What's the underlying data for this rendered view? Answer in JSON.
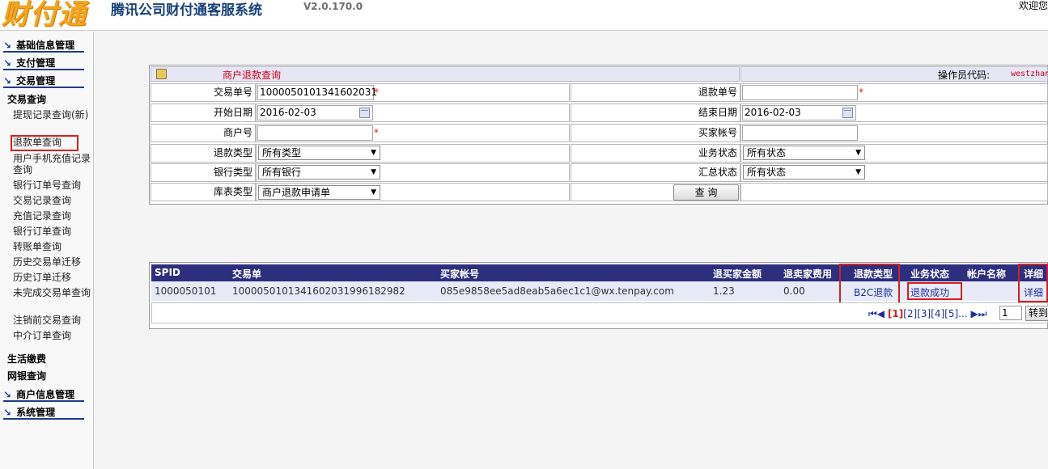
{
  "header": {
    "logo": "财付通",
    "title": "腾讯公司财付通客服系统",
    "version": "V2.0.170.0",
    "welcome": "欢迎您"
  },
  "sidebar": {
    "sections": [
      {
        "label": "基础信息管理"
      },
      {
        "label": "支付管理"
      },
      {
        "label": "交易管理"
      }
    ],
    "trade_query_heading": "交易查询",
    "items": [
      "提现记录查询(新)",
      "退款单查询",
      "用户手机充值记录查询",
      "银行订单号查询",
      "交易记录查询",
      "充值记录查询",
      "银行订单查询",
      "转账单查询",
      "历史交易单迁移",
      "历史订单迁移",
      "未完成交易单查询",
      "注销前交易查询",
      "中介订单查询"
    ],
    "life_pay": "生活缴费",
    "bank_query": "网银查询",
    "bottom_sections": [
      {
        "label": "商户信息管理"
      },
      {
        "label": "系统管理"
      }
    ]
  },
  "query": {
    "title": "商户退款查询",
    "operator_label": "操作员代码:",
    "operator_value": "westzhan",
    "trade_no_label": "交易单号",
    "trade_no_value": "1000050101341602031",
    "refund_no_label": "退款单号",
    "refund_no_value": "",
    "start_date_label": "开始日期",
    "start_date_value": "2016-02-03",
    "end_date_label": "结束日期",
    "end_date_value": "2016-02-03",
    "merchant_no_label": "商户号",
    "merchant_no_value": "",
    "buyer_account_label": "买家帐号",
    "buyer_account_value": "",
    "refund_type_label": "退款类型",
    "refund_type_value": "所有类型",
    "business_status_label": "业务状态",
    "business_status_value": "所有状态",
    "bank_type_label": "银行类型",
    "bank_type_value": "所有银行",
    "summary_status_label": "汇总状态",
    "summary_status_value": "所有状态",
    "table_type_label": "库表类型",
    "table_type_value": "商户退款申请单",
    "query_button": "查 询",
    "required_mark": "*"
  },
  "results": {
    "columns": [
      "SPID",
      "交易单",
      "买家帐号",
      "退买家金额",
      "退卖家费用",
      "退款类型",
      "业务状态",
      "帐户名称",
      "详细"
    ],
    "rows": [
      {
        "spid": "1000050101",
        "trade": "1000050101341602031996182982",
        "buyer": "085e9858ee5ad8eab5a6ec1c1@wx.tenpay.com",
        "refund_buyer": "1.23",
        "refund_seller": "0.00",
        "refund_type": "B2C退款",
        "status": "退款成功",
        "account_name": "",
        "detail": "详细"
      }
    ],
    "pager": {
      "prev": "⏮◀",
      "current": "[1]",
      "pages": "[2][3][4][5]...",
      "next": "▶⏭",
      "page_input": "1",
      "goto_button": "转到"
    }
  }
}
